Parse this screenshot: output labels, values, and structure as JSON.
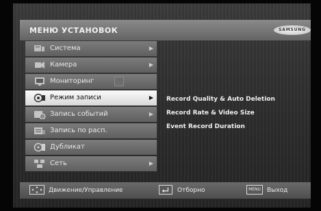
{
  "menu": {
    "title": "МЕНЮ УСТАНОВОК",
    "brand": "SAMSUNG",
    "items": [
      {
        "label": "Система",
        "icon": "system-icon",
        "has_submenu": true,
        "selected": false
      },
      {
        "label": "Камера",
        "icon": "camera-icon",
        "has_submenu": true,
        "selected": false
      },
      {
        "label": "Мониторинг",
        "icon": "monitor-icon",
        "has_submenu": false,
        "selected": false
      },
      {
        "label": "Режим записи",
        "icon": "record-mode-icon",
        "has_submenu": true,
        "selected": true
      },
      {
        "label": "Запись событий",
        "icon": "event-record-icon",
        "has_submenu": true,
        "selected": false
      },
      {
        "label": "Запись по расп.",
        "icon": "schedule-record-icon",
        "has_submenu": false,
        "selected": false
      },
      {
        "label": "Дубликат",
        "icon": "backup-icon",
        "has_submenu": false,
        "selected": false
      },
      {
        "label": "Сеть",
        "icon": "network-icon",
        "has_submenu": true,
        "selected": false
      }
    ],
    "arrow_glyph": "▶"
  },
  "submenu": {
    "items": [
      "Record Quality & Auto Deletion",
      "Record Rate & Video Size",
      "Event Record Duration"
    ]
  },
  "footer": {
    "move_label": "Движение/Управление",
    "enter_label": "Отборно",
    "exit_key": "MENU",
    "exit_label": "Выход"
  },
  "colors": {
    "selected_bg": "#f0f0f0",
    "item_bg": "#6e6e6e",
    "title_bar": "#787878"
  }
}
